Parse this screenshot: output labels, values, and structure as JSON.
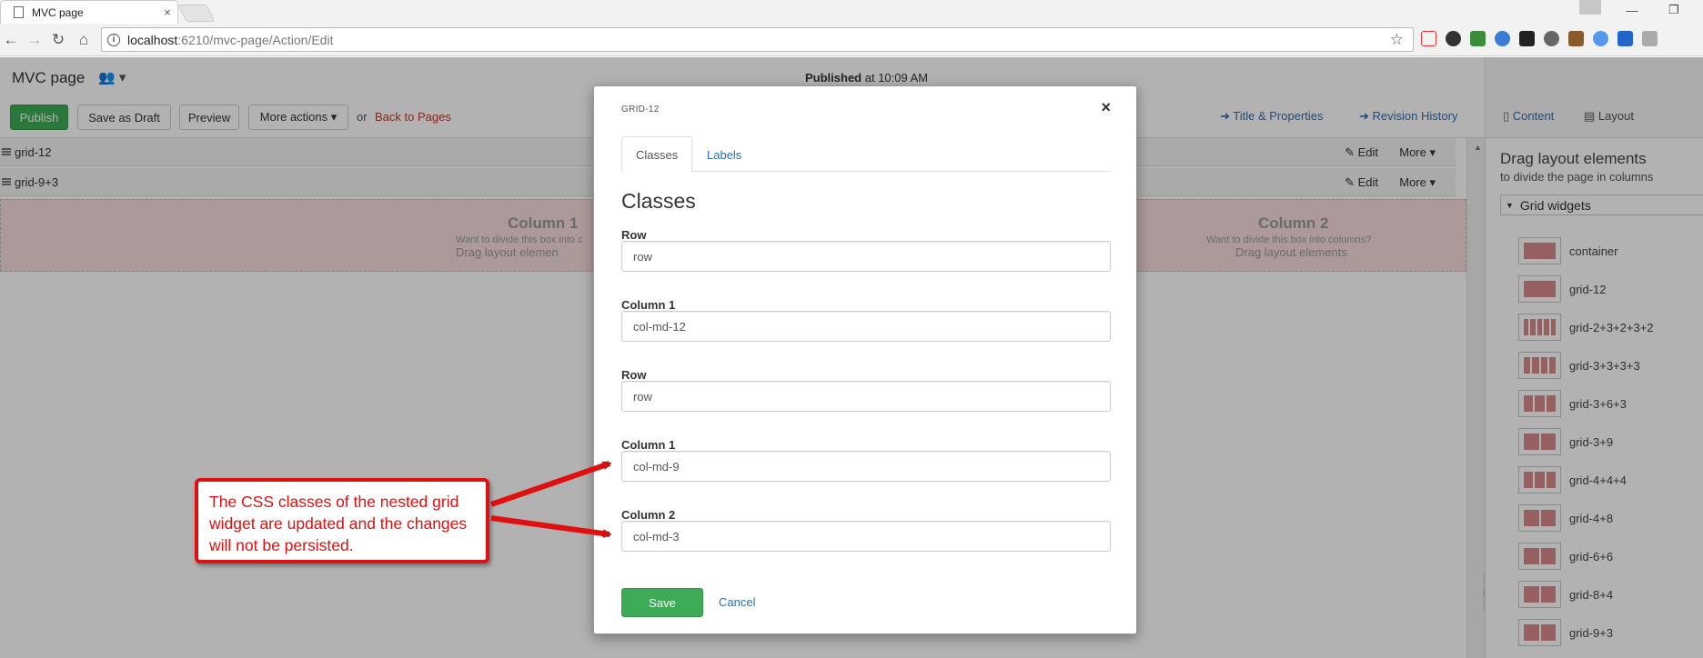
{
  "browser": {
    "tab_title": "MVC page",
    "tab_close": "×",
    "url_host": "localhost",
    "url_path": ":6210/mvc-page/Action/Edit",
    "win_min": "—",
    "win_restore": "❐"
  },
  "header": {
    "page_title": "MVC page",
    "published_label": "Published",
    "published_time": " at 10:09 AM",
    "buttons": {
      "publish": "Publish",
      "save_draft": "Save as Draft",
      "preview": "Preview",
      "more_actions": "More actions ▾"
    },
    "or": "or",
    "back_to_pages": "Back to Pages",
    "title_properties": "Title & Properties",
    "revision_history": "Revision History"
  },
  "sidebar": {
    "tab_content": "Content",
    "tab_layout": "Layout",
    "heading": "Drag layout elements",
    "subheading": "to divide the page in columns",
    "group": "Grid widgets",
    "widgets": [
      {
        "label": "container",
        "cols": 1
      },
      {
        "label": "grid-12",
        "cols": 1
      },
      {
        "label": "grid-2+3+2+3+2",
        "cols": 5
      },
      {
        "label": "grid-3+3+3+3",
        "cols": 4
      },
      {
        "label": "grid-3+6+3",
        "cols": 3
      },
      {
        "label": "grid-3+9",
        "cols": 2
      },
      {
        "label": "grid-4+4+4",
        "cols": 3
      },
      {
        "label": "grid-4+8",
        "cols": 2
      },
      {
        "label": "grid-6+6",
        "cols": 2
      },
      {
        "label": "grid-8+4",
        "cols": 2
      },
      {
        "label": "grid-9+3",
        "cols": 2
      }
    ]
  },
  "layout_rows": {
    "row1": "grid-12",
    "row2": "grid-9+3",
    "edit": "✎ Edit",
    "more": "More ▾"
  },
  "dropzone": {
    "col1_title": "Column 1",
    "col1_sub": "Want to divide this box into c",
    "col1_sub2": "Drag layout elemen",
    "col2_title": "Column 2",
    "col2_sub": "Want to divide this box into columns?",
    "col2_sub2": "Drag layout elements"
  },
  "modal": {
    "title": "GRID-12",
    "close": "×",
    "tab_classes": "Classes",
    "tab_labels": "Labels",
    "section_title": "Classes",
    "fields": [
      {
        "label": "Row",
        "value": "row"
      },
      {
        "label": "Column 1",
        "value": "col-md-12"
      },
      {
        "label": "Row",
        "value": "row"
      },
      {
        "label": "Column 1",
        "value": "col-md-9"
      },
      {
        "label": "Column 2",
        "value": "col-md-3"
      }
    ],
    "save": "Save",
    "cancel": "Cancel"
  },
  "annotation": {
    "text": "The CSS classes of the nested grid widget are updated and the changes will not be persisted.",
    "color": "#e01010"
  },
  "colors": {
    "publish_green": "#3eac57",
    "link_blue": "#2a6fb5",
    "back_red": "#c0392b",
    "dropzone_pink": "#f7dddd"
  }
}
